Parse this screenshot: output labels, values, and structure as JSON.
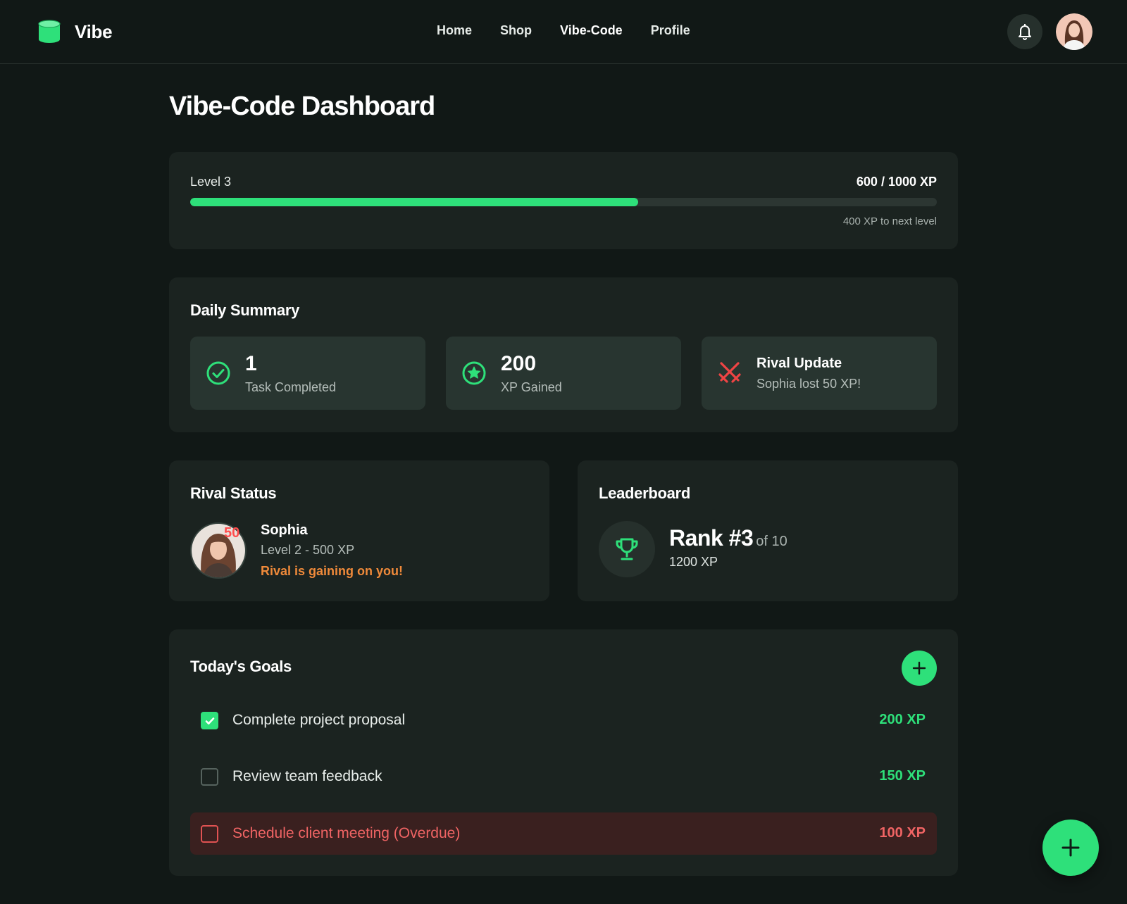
{
  "app": {
    "name": "Vibe"
  },
  "nav": {
    "items": [
      {
        "label": "Home"
      },
      {
        "label": "Shop"
      },
      {
        "label": "Vibe-Code",
        "active": true
      },
      {
        "label": "Profile"
      }
    ]
  },
  "page": {
    "title": "Vibe-Code Dashboard"
  },
  "level": {
    "label": "Level 3",
    "xp": "600 / 1000 XP",
    "progress_percent": 60,
    "next": "400 XP to next level"
  },
  "summary": {
    "title": "Daily Summary",
    "tasks": {
      "value": "1",
      "label": "Task Completed",
      "icon": "check-circle-icon"
    },
    "xp": {
      "value": "200",
      "label": "XP Gained",
      "icon": "star-circle-icon"
    },
    "rival_update": {
      "title": "Rival Update",
      "text": "Sophia lost 50 XP!",
      "icon": "crossed-swords-icon"
    }
  },
  "rival": {
    "title": "Rival Status",
    "name": "Sophia",
    "badge": "50",
    "level": "Level 2 - 500 XP",
    "warning": "Rival is gaining on you!"
  },
  "leaderboard": {
    "title": "Leaderboard",
    "rank": "Rank #3",
    "of": "of 10",
    "xp": "1200 XP",
    "icon": "trophy-icon"
  },
  "goals": {
    "title": "Today's Goals",
    "items": [
      {
        "text": "Complete project proposal",
        "xp": "200 XP",
        "checked": true,
        "overdue": false
      },
      {
        "text": "Review team feedback",
        "xp": "150 XP",
        "checked": false,
        "overdue": false
      },
      {
        "text": "Schedule client meeting (Overdue)",
        "xp": "100 XP",
        "checked": false,
        "overdue": true
      }
    ]
  },
  "colors": {
    "accent": "#2ee07a",
    "background": "#111816",
    "card": "#1b2320",
    "danger": "#f06464",
    "warning": "#f08a3a"
  }
}
